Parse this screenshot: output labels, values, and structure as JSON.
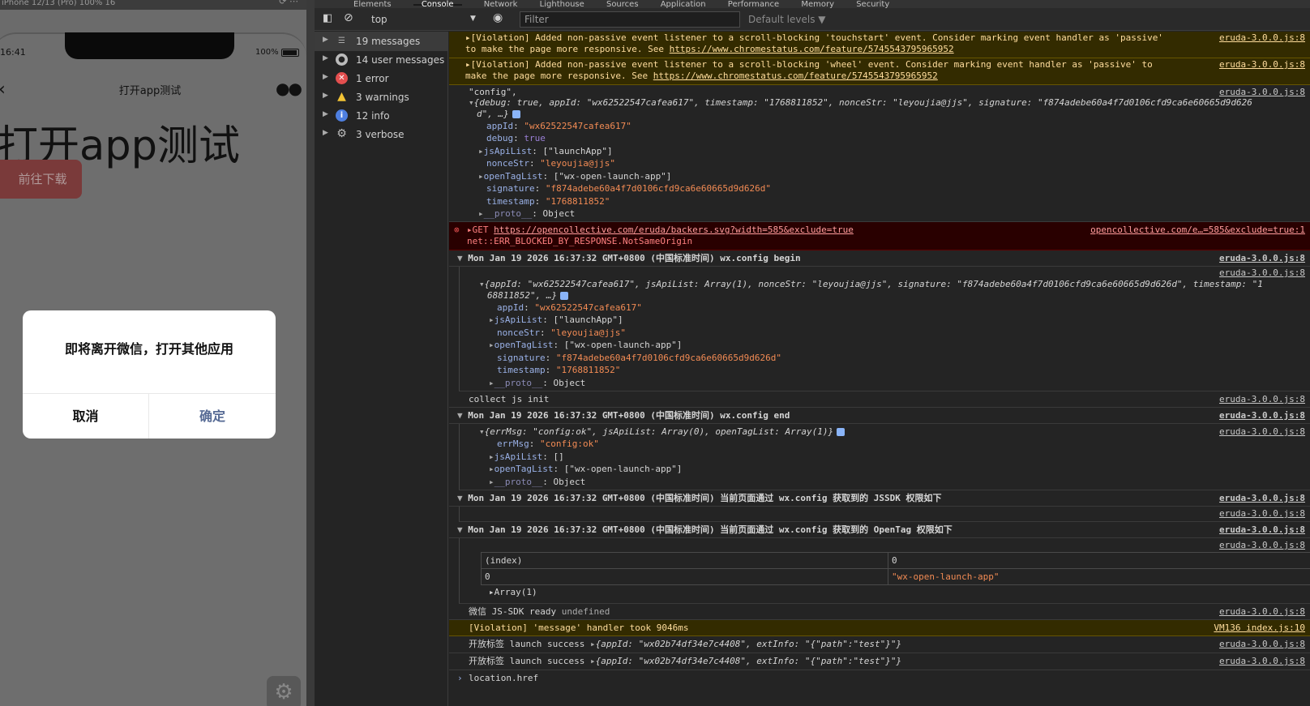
{
  "device": {
    "topbar_text": "iPhone 12/13 (Pro) 100% 16",
    "status_time": "16:41",
    "battery": "100%",
    "nav_title": "打开app测试",
    "page_heading": "打开app测试",
    "download_button": "前往下载",
    "dialog": {
      "message": "即将离开微信，打开其他应用",
      "cancel": "取消",
      "confirm": "确定"
    }
  },
  "devtools": {
    "tabs": [
      "Elements",
      "Console",
      "Network",
      "Lighthouse",
      "Sources",
      "Application",
      "Performance",
      "Memory",
      "Security"
    ],
    "toolbar": {
      "context": "top",
      "filter_placeholder": "Filter",
      "levels": "Default levels ▼"
    },
    "sidebar": [
      {
        "label": "19 messages",
        "icon": "list-icon"
      },
      {
        "label": "14 user messages",
        "icon": "user-icon"
      },
      {
        "label": "1 error",
        "icon": "error-icon"
      },
      {
        "label": "3 warnings",
        "icon": "warning-icon"
      },
      {
        "label": "12 info",
        "icon": "info-icon"
      },
      {
        "label": "3 verbose",
        "icon": "gear-icon"
      }
    ],
    "console": {
      "src_eruda": "eruda-3.0.0.js:8",
      "src_oc": "opencollective.com/e…=585&exclude=true:1",
      "src_vm": "VM136 index.js:10",
      "violation_touch_a": "▸[Violation] Added non-passive event listener to a scroll-blocking 'touchstart' event. Consider marking event handler as 'passive'",
      "violation_touch_b": "to make the page more responsive. See ",
      "violation_wheel_a": "▸[Violation] Added non-passive event listener to a scroll-blocking 'wheel' event. Consider marking event handler as 'passive' to",
      "violation_wheel_b": "make the page more responsive. See ",
      "chromestatus_url": "https://www.chromestatus.com/feature/5745543795965952",
      "config_label": "\"config\",",
      "config_summary_line1": "{debug: true, appId: \"wx62522547cafea617\", timestamp: \"1768811852\", nonceStr: \"leyoujia@jjs\", signature: \"f874adebe60a4f7d0106cfd9ca6e60665d9d626",
      "config_summary_line2": "d\", …}",
      "appId": "\"wx62522547cafea617\"",
      "debug": "true",
      "jsApiList": "[\"launchApp\"]",
      "nonceStr": "\"leyoujia@jjs\"",
      "openTagList": "[\"wx-open-launch-app\"]",
      "signature": "\"f874adebe60a4f7d0106cfd9ca6e60665d9d626d\"",
      "timestamp": "\"1768811852\"",
      "proto": "Object",
      "get_prefix": "▸GET ",
      "get_url": "https://opencollective.com/eruda/backers.svg?width=585&exclude=true",
      "get_error": "net::ERR_BLOCKED_BY_RESPONSE.NotSameOrigin",
      "group_begin": "Mon Jan 19 2026 16:37:32 GMT+0800 (中国标准时间) wx.config begin",
      "obj2_line1": "{appId: \"wx62522547cafea617\", jsApiList: Array(1), nonceStr: \"leyoujia@jjs\", signature: \"f874adebe60a4f7d0106cfd9ca6e60665d9d626d\", timestamp: \"1",
      "obj2_line2": "68811852\", …}",
      "collect_init": "collect js init",
      "group_end": "Mon Jan 19 2026 16:37:32 GMT+0800 (中国标准时间) wx.config end",
      "obj3_line": "{errMsg: \"config:ok\", jsApiList: Array(0), openTagList: Array(1)}",
      "errMsg": "\"config:ok\"",
      "jsApiList_empty": "[]",
      "group_jssdk": "Mon Jan 19 2026 16:37:32 GMT+0800 (中国标准时间) 当前页面通过 wx.config 获取到的 JSSDK 权限如下",
      "group_opentag": "Mon Jan 19 2026 16:37:32 GMT+0800 (中国标准时间) 当前页面通过 wx.config 获取到的 OpenTag 权限如下",
      "table": {
        "col1": "(index)",
        "col2": "0",
        "row_index": "0",
        "row_value": "\"wx-open-launch-app\""
      },
      "array_summary": "▸Array(1)",
      "ready_text": "微信 JS-SDK ready",
      "ready_value": "undefined",
      "violation_message": "[Violation] 'message' handler took 9046ms",
      "launch_text": "开放标签 launch success",
      "launch_obj": "{appId: \"wx02b74df34e7c4408\", extInfo: \"{\"path\":\"test\"}\"}",
      "prompt_input": "location.href"
    }
  },
  "colors": {
    "warning_bg": "#332b00",
    "error_bg": "#290000",
    "string": "#f28b54",
    "key": "#9ab1e7",
    "dialog_confirm": "#576b95"
  }
}
